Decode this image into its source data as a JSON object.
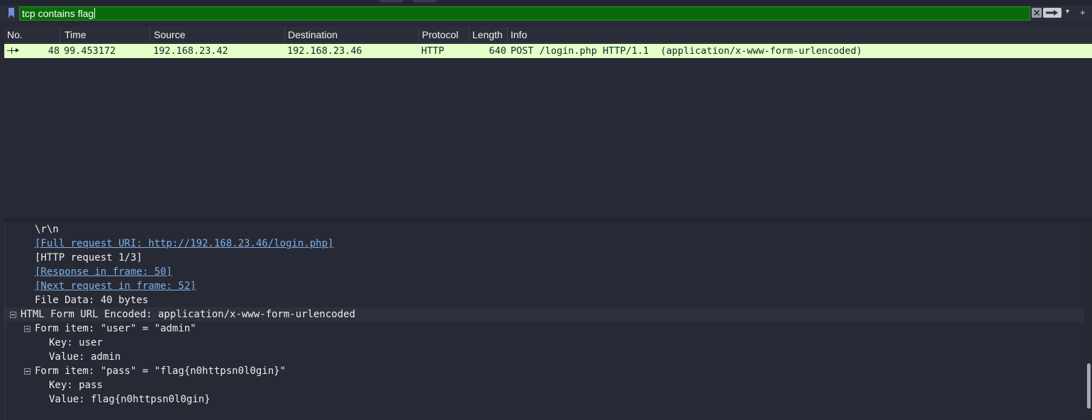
{
  "filter": {
    "value": "tcp contains flag",
    "icons": [
      "bookmark-icon",
      "clear-icon",
      "apply-arrow-icon",
      "chevron-down-icon",
      "plus-icon"
    ]
  },
  "packet_list": {
    "columns": [
      "No.",
      "Time",
      "Source",
      "Destination",
      "Protocol",
      "Length",
      "Info"
    ],
    "rows": [
      {
        "no": "48",
        "time": "99.453172",
        "source": "192.168.23.42",
        "destination": "192.168.23.46",
        "protocol": "HTTP",
        "length": "640",
        "info": "POST /login.php HTTP/1.1  (application/x-www-form-urlencoded)"
      }
    ],
    "row_color": "#e4ffc7"
  },
  "details": {
    "lines": [
      "\\r\\n",
      "[Full request URI: http://192.168.23.46/login.php]",
      "[HTTP request 1/3]",
      "[Response in frame: 50]",
      "[Next request in frame: 52]",
      "File Data: 40 bytes",
      "HTML Form URL Encoded: application/x-www-form-urlencoded",
      "Form item: \"user\" = \"admin\"",
      "Key: user",
      "Value: admin",
      "Form item: \"pass\" = \"flag{n0httpsn0l0gin}\"",
      "Key: pass",
      "Value: flag{n0httpsn0l0gin}"
    ]
  },
  "colors": {
    "filter_valid": "#0a6b0a",
    "background": "#272a35",
    "link": "#7fb0e8"
  }
}
